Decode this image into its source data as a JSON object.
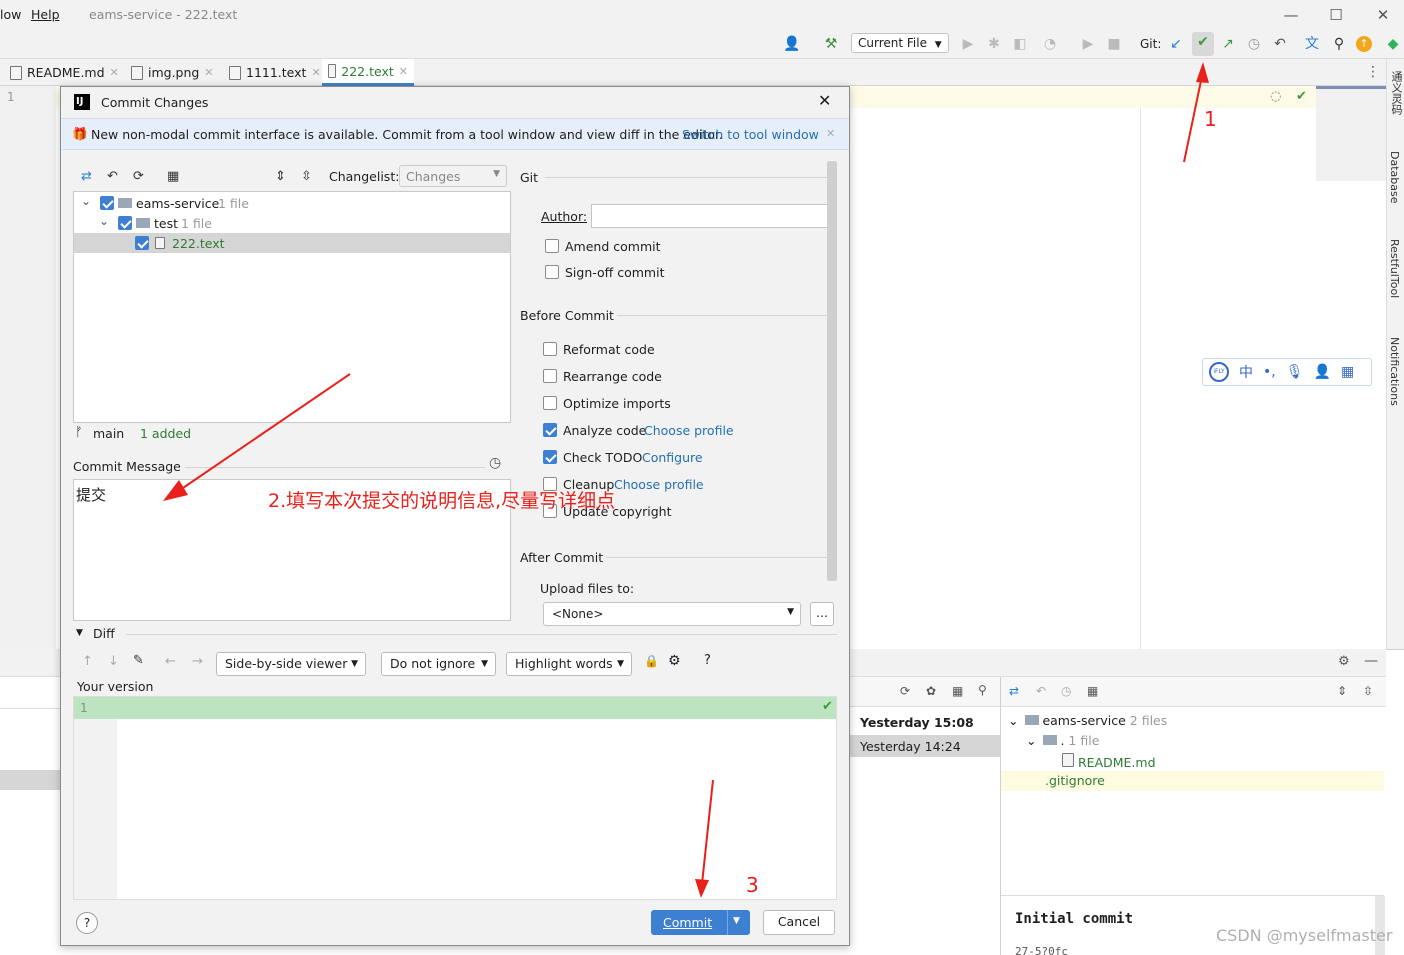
{
  "titlebar": {
    "menu_window": "low",
    "menu_help": "Help",
    "title": "eams-service - 222.text"
  },
  "toolbar": {
    "current_file": "Current File",
    "git_label": "Git:"
  },
  "tabs": [
    {
      "label": "README.md"
    },
    {
      "label": "img.png"
    },
    {
      "label": "1111.text"
    },
    {
      "label": "222.text"
    }
  ],
  "editor": {
    "line_number": "1"
  },
  "right_sidebar": {
    "translate": "通义灵码",
    "database": "Database",
    "restful": "RestfulTool",
    "notifications": "Notifications"
  },
  "ime_toolbar": {
    "logo": "iFLY",
    "lang": "中"
  },
  "dialog": {
    "title": "Commit Changes",
    "banner_text": "New non-modal commit interface is available. Commit from a tool window and view diff in the editor.",
    "banner_link": "Switch to tool window",
    "changelist_label": "Changelist:",
    "changelist_value": "Changes",
    "tree": {
      "root_name": "eams-service",
      "root_count": "1 file",
      "folder_name": "test",
      "folder_count": "1 file",
      "file_name": "222.text"
    },
    "branch": "main",
    "branch_status": "1 added",
    "commit_message_label": "Commit Message",
    "commit_message": "提交",
    "git_section": "Git",
    "author_label": "Author:",
    "amend": "Amend commit",
    "signoff": "Sign-off commit",
    "before_commit": "Before Commit",
    "reformat": "Reformat code",
    "rearrange": "Rearrange code",
    "optimize": "Optimize imports",
    "analyze": "Analyze code",
    "analyze_link": "Choose profile",
    "todo": "Check TODO",
    "todo_link": "Configure",
    "cleanup": "Cleanup",
    "cleanup_link": "Choose profile",
    "update_copyright": "Update copyright",
    "after_commit": "After Commit",
    "upload_label": "Upload files to:",
    "upload_value": "<None>",
    "upload_more": "...",
    "diff_label": "Diff",
    "viewer": "Side-by-side viewer",
    "ignore": "Do not ignore",
    "highlight": "Highlight words",
    "help_glyph": "?",
    "your_version": "Your version",
    "diff_line": "1",
    "commit_button": "Commit",
    "cancel_button": "Cancel"
  },
  "history": {
    "row1": "Yesterday 15:08",
    "row2": "Yesterday 14:24"
  },
  "log_tree": {
    "root_name": "eams-service",
    "root_count": "2 files",
    "folder_name": ".",
    "folder_count": "1 file",
    "file1": "README.md",
    "file2": ".gitignore",
    "commit_title": "Initial commit",
    "partial": "27-5?0fc"
  },
  "annotations": {
    "step1": "1",
    "step2": "2.填写本次提交的说明信息,尽量写详细点",
    "step3": "3"
  },
  "watermark": "CSDN @myselfmaster",
  "colors": {
    "accent": "#3d7fd1",
    "added_file": "#2e7d32",
    "annotation": "#e8211b",
    "diff_added": "#bde4c0"
  }
}
